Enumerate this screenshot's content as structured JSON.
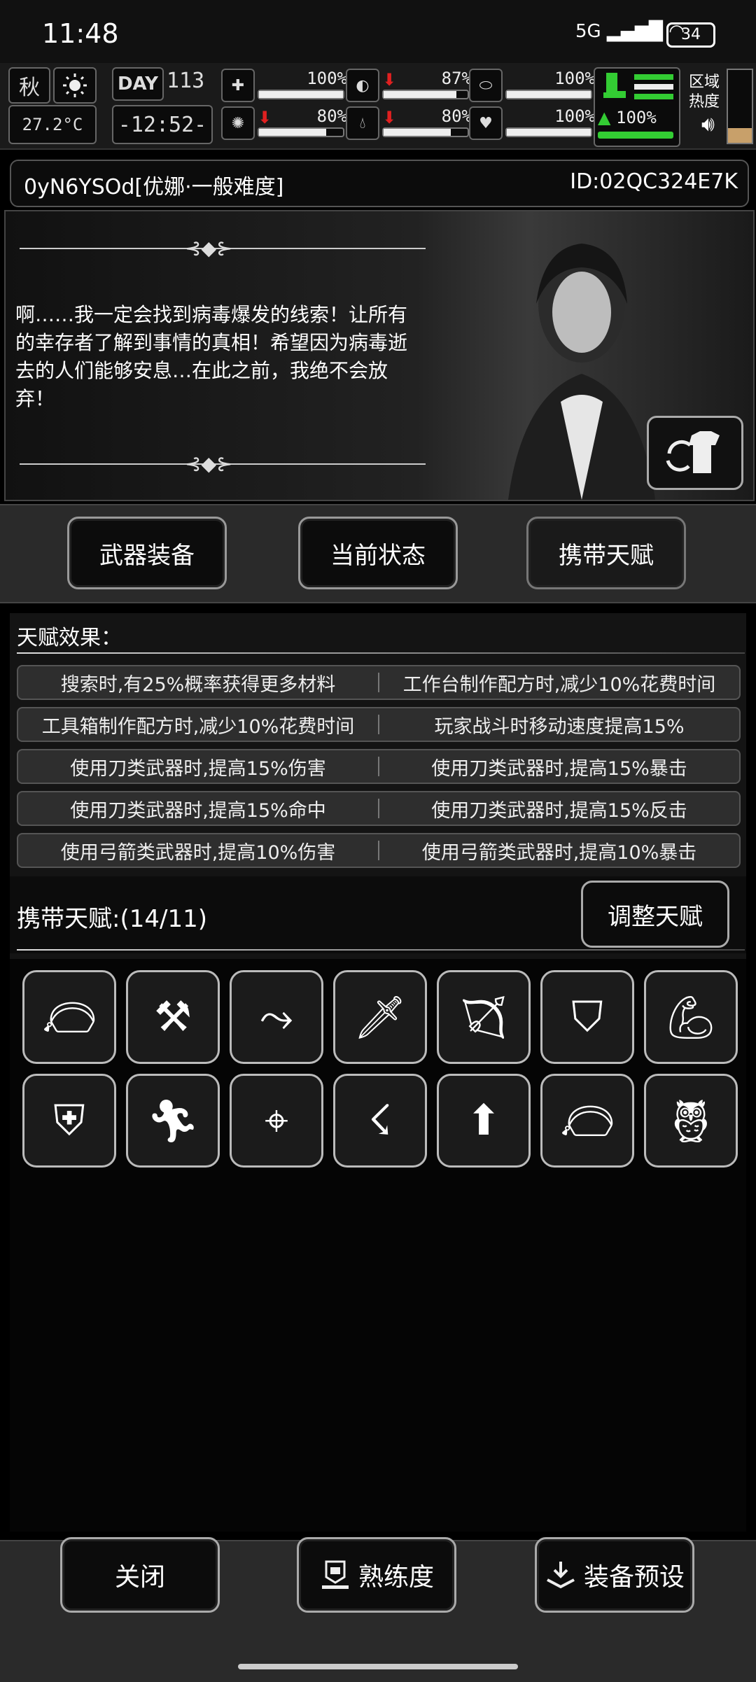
{
  "status_bar": {
    "time": "11:48",
    "network": "5G",
    "battery": "34"
  },
  "hud": {
    "season": "秋",
    "day_label": "DAY",
    "day_number": "113",
    "temperature": "27.2°C",
    "clock": "-12:52-",
    "stats": [
      {
        "name": "health-icon",
        "value": "100%",
        "level": 1.0,
        "arrow": ""
      },
      {
        "name": "stomach-icon",
        "value": "87%",
        "level": 0.87,
        "arrow": "down"
      },
      {
        "name": "stamina-icon",
        "value": "100%",
        "level": 1.0,
        "arrow": ""
      },
      {
        "name": "brain-icon",
        "value": "80%",
        "level": 0.8,
        "arrow": "down"
      },
      {
        "name": "water-icon",
        "value": "80%",
        "level": 0.8,
        "arrow": "down"
      },
      {
        "name": "heart-icon",
        "value": "100%",
        "level": 1.0,
        "arrow": ""
      }
    ],
    "boot_value": "100%",
    "zone_label": "区域\n热度"
  },
  "character": {
    "name": "0yN6YSOd[优娜·一般难度]",
    "id": "ID:02QC324E7K",
    "quote": "啊……我一定会找到病毒爆发的线索！让所有的幸存者了解到事情的真相！希望因为病毒逝去的人们能够安息…在此之前，我绝不会放弃！"
  },
  "tabs": [
    {
      "label": "武器装备"
    },
    {
      "label": "当前状态"
    },
    {
      "label": "携带天赋"
    }
  ],
  "effects_title": "天赋效果：",
  "effects": [
    [
      "搜索时,有25%概率获得更多材料",
      "工作台制作配方时,减少10%花费时间"
    ],
    [
      "工具箱制作配方时,减少10%花费时间",
      "玩家战斗时移动速度提高15%"
    ],
    [
      "使用刀类武器时,提高15%伤害",
      "使用刀类武器时,提高15%暴击"
    ],
    [
      "使用刀类武器时,提高15%命中",
      "使用刀类武器时,提高15%反击"
    ],
    [
      "使用弓箭类武器时,提高10%伤害",
      "使用弓箭类武器时,提高10%暴击"
    ]
  ],
  "carry": {
    "label": "携带天赋:(14/11)",
    "adjust_label": "调整天赋"
  },
  "talent_icons": [
    "loot-bag-icon",
    "tools-icon",
    "slide-kick-icon",
    "blade-up-icon",
    "bow-up-icon",
    "shield-up-icon",
    "muscle-icon",
    "armor-up-icon",
    "sprint-icon",
    "target-up-icon",
    "claw-icon",
    "boot-up-icon",
    "loot-bag-icon",
    "owl-icon"
  ],
  "bottom": {
    "close_label": "关闭",
    "proficiency_label": "熟练度",
    "preset_label": "装备预设"
  }
}
